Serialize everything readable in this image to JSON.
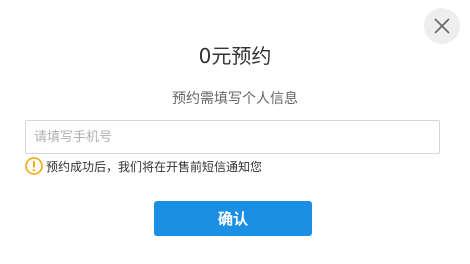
{
  "dialog": {
    "title": "0元预约",
    "subtitle": "预约需填写个人信息",
    "phone_placeholder": "请填写手机号",
    "phone_value": "",
    "notice_text": "预约成功后，我们将在开售前短信通知您",
    "confirm_label": "确认",
    "icons": {
      "close": "close-icon",
      "warning": "warning-icon"
    }
  },
  "colors": {
    "accent": "#1a8fe3",
    "warning": "#f0a500",
    "close_bg": "#eeeeee"
  }
}
